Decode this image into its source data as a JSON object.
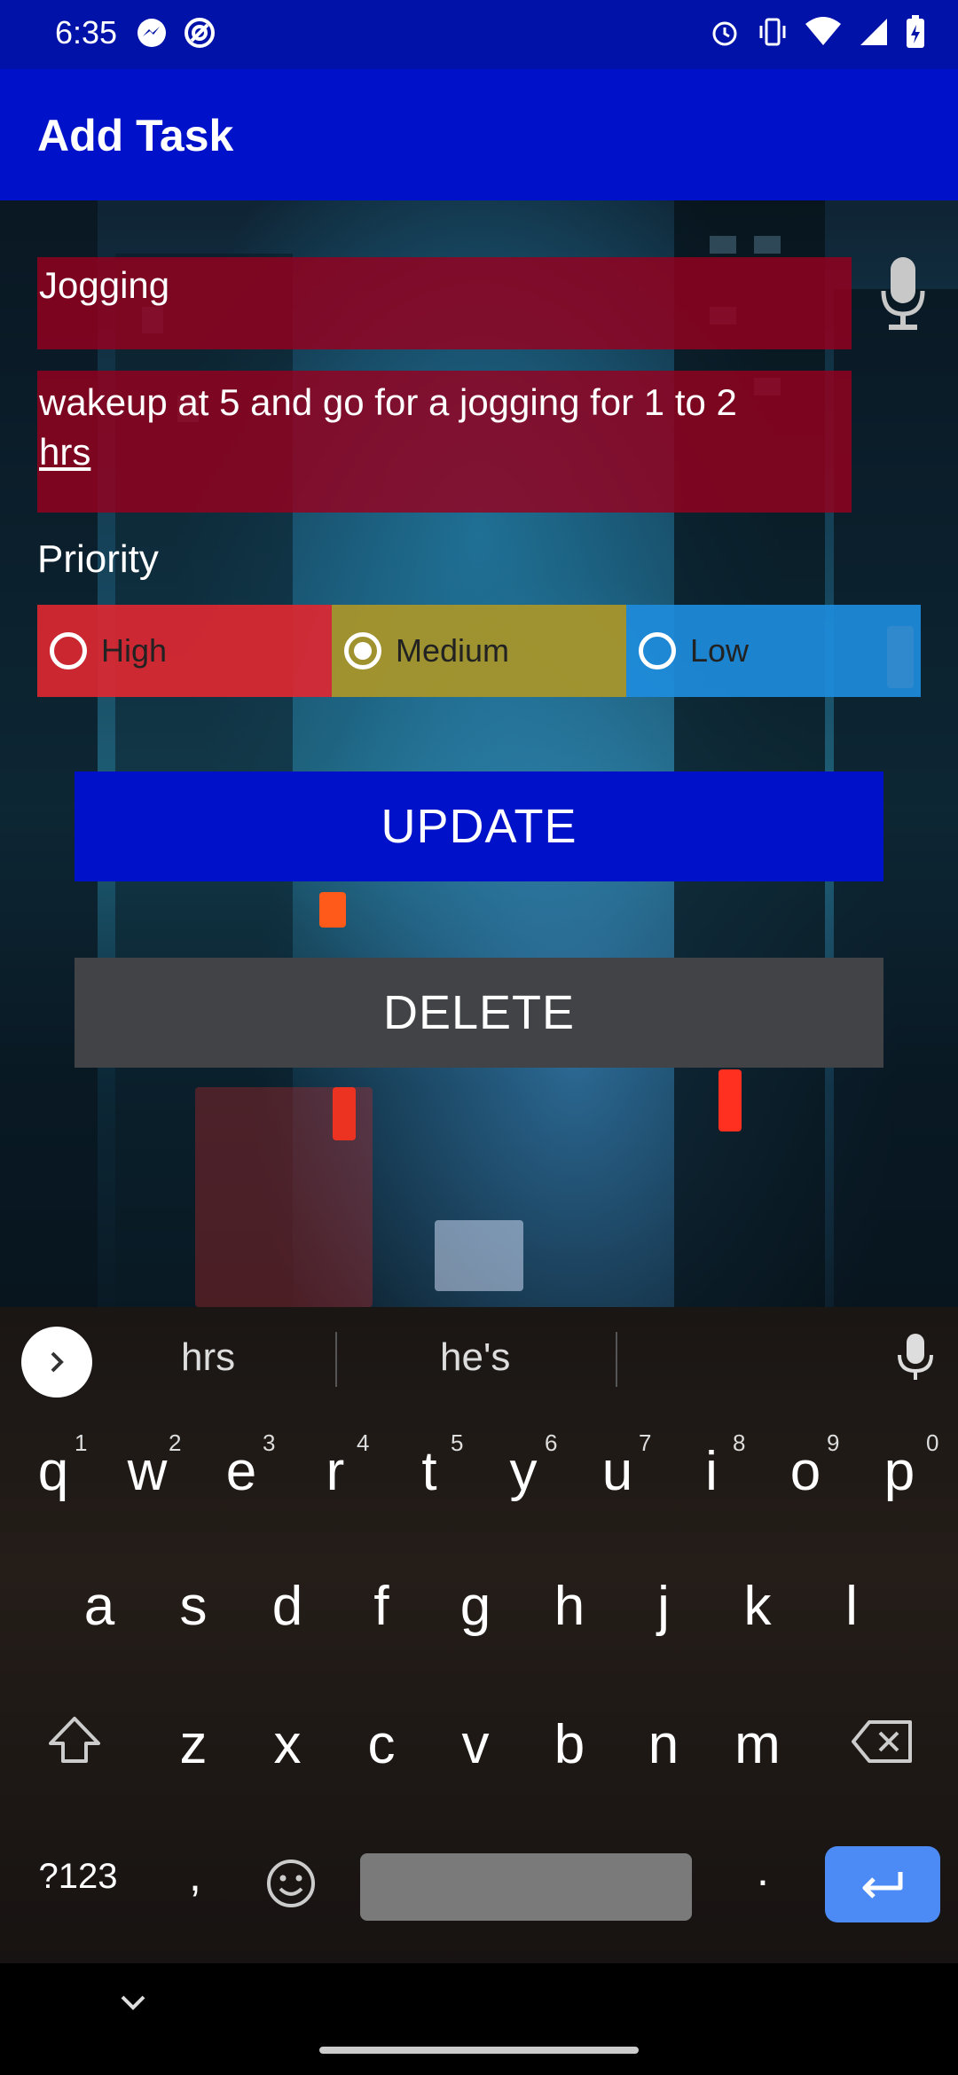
{
  "status_bar": {
    "time": "6:35",
    "left_icons": [
      "messenger-icon",
      "signal-app-icon"
    ],
    "right_icons": [
      "alarm-icon",
      "vibrate-icon",
      "wifi-icon",
      "cell-signal-icon",
      "battery-icon"
    ]
  },
  "app_bar": {
    "title": "Add Task"
  },
  "form": {
    "title_value": "Jogging",
    "description_value_line1": "wakeup at 5 and go for a jogging for 1 to 2",
    "description_value_line2": "hrs",
    "priority_label": "Priority",
    "priority_options": [
      {
        "label": "High",
        "selected": false,
        "color": "#dc2832"
      },
      {
        "label": "Medium",
        "selected": true,
        "color": "#aa9628"
      },
      {
        "label": "Low",
        "selected": false,
        "color": "#1e8cdc"
      }
    ],
    "update_label": "UPDATE",
    "delete_label": "DELETE"
  },
  "keyboard": {
    "suggestions": [
      "hrs",
      "he's"
    ],
    "row1": [
      "q",
      "w",
      "e",
      "r",
      "t",
      "y",
      "u",
      "i",
      "o",
      "p"
    ],
    "row1_hints": [
      "1",
      "2",
      "3",
      "4",
      "5",
      "6",
      "7",
      "8",
      "9",
      "0"
    ],
    "row2": [
      "a",
      "s",
      "d",
      "f",
      "g",
      "h",
      "j",
      "k",
      "l"
    ],
    "row3": [
      "z",
      "x",
      "c",
      "v",
      "b",
      "n",
      "m"
    ],
    "symbols_label": "?123",
    "comma": ",",
    "period": "."
  },
  "colors": {
    "status_bar": "#0012a8",
    "app_bar": "#0012c9",
    "input_bg": "#96001e",
    "update_button": "#0012c9",
    "delete_button": "#414346",
    "enter_key": "#4c8bf5"
  }
}
